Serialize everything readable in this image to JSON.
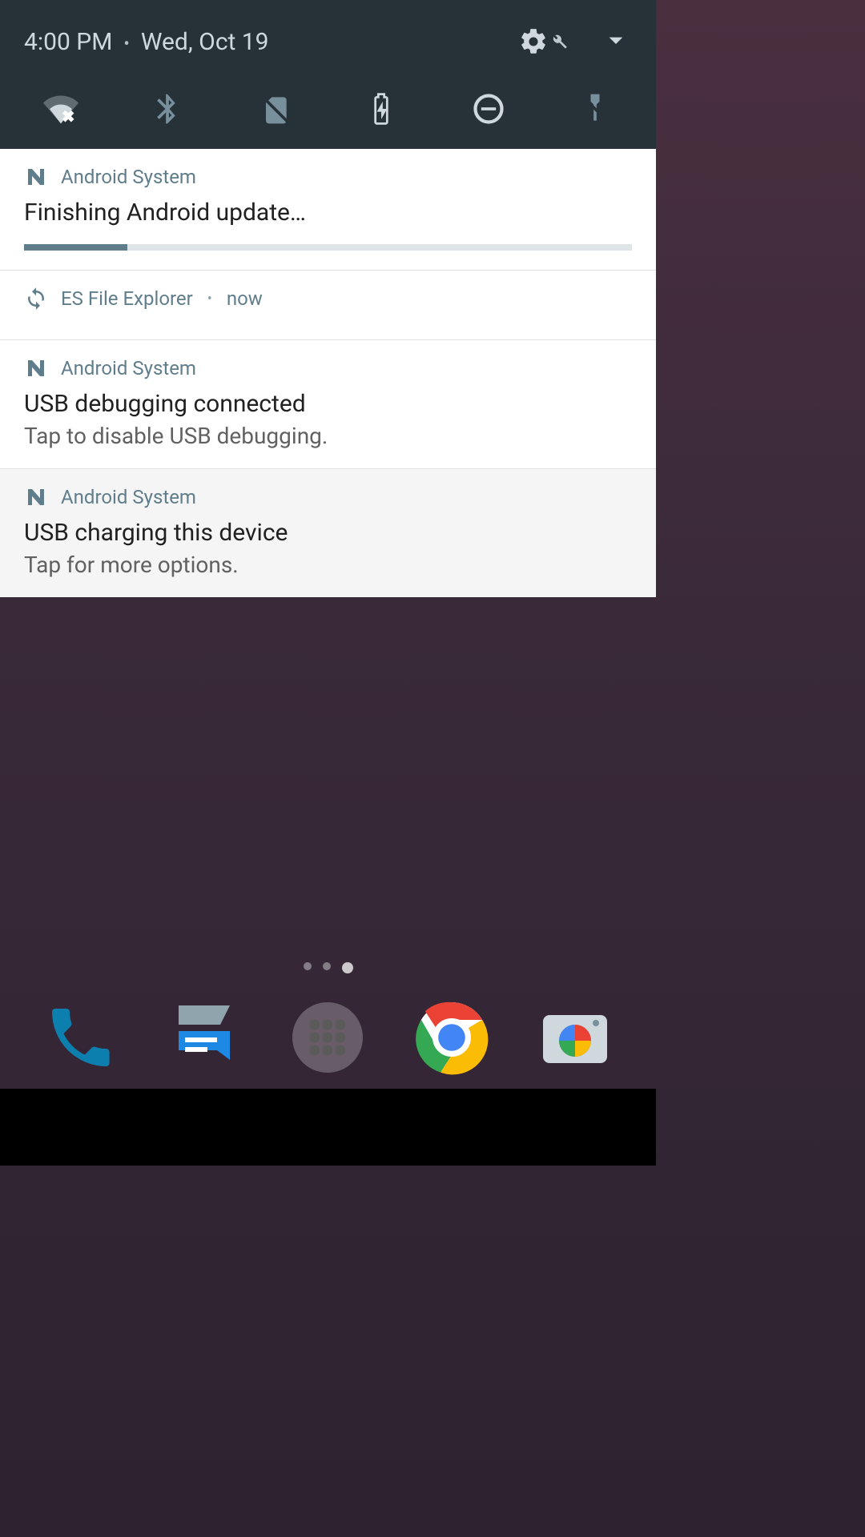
{
  "header": {
    "time": "4:00 PM",
    "date": "Wed, Oct 19"
  },
  "quick_settings": {
    "wifi": {
      "name": "wifi-no-internet-icon"
    },
    "bluetooth": {
      "name": "bluetooth-off-icon"
    },
    "sim": {
      "name": "no-sim-icon"
    },
    "battery": {
      "name": "battery-charging-icon"
    },
    "dnd": {
      "name": "do-not-disturb-icon"
    },
    "flashlight": {
      "name": "flashlight-off-icon"
    }
  },
  "notifications": [
    {
      "app": "Android System",
      "icon": "android-n-icon",
      "title": "Finishing Android update…",
      "subtitle": "",
      "progress_pct": 17
    },
    {
      "app": "ES File Explorer",
      "icon": "sync-icon",
      "time": "now",
      "title": "",
      "subtitle": ""
    },
    {
      "app": "Android System",
      "icon": "android-n-icon",
      "title": "USB debugging connected",
      "subtitle": "Tap to disable USB debugging."
    },
    {
      "app": "Android System",
      "icon": "android-n-icon",
      "title": "USB charging this device",
      "subtitle": "Tap for more options.",
      "muted": true
    }
  ],
  "home": {
    "page_count": 3,
    "active_page": 2,
    "dock": [
      {
        "name": "phone-app-icon"
      },
      {
        "name": "messages-app-icon"
      },
      {
        "name": "app-drawer-icon"
      },
      {
        "name": "chrome-app-icon"
      },
      {
        "name": "camera-app-icon"
      }
    ]
  }
}
